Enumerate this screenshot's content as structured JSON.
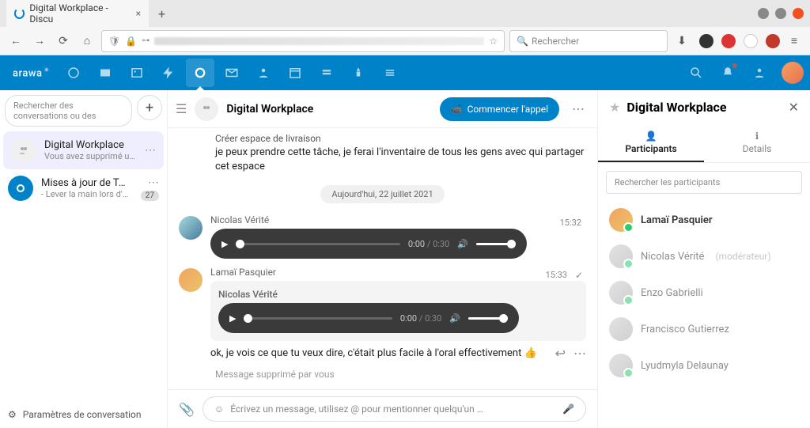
{
  "browser": {
    "tab_title": "Digital Workplace - Discu",
    "search_placeholder": "Rechercher"
  },
  "app": {
    "brand": "arawa"
  },
  "sidebar": {
    "search_placeholder": "Rechercher des conversations ou des",
    "items": [
      {
        "title": "Digital Workplace",
        "subtitle": "Vous avez supprimé un mes…"
      },
      {
        "title": "Mises à jour de Talk ✅",
        "subtitle": "- Lever la main lors d'u…",
        "badge": "27"
      }
    ],
    "footer": "Paramètres de conversation"
  },
  "chat": {
    "title": "Digital Workplace",
    "start_call": "Commencer l'appel",
    "system_line": "Créer espace de livraison",
    "intro_msg": "je peux prendre cette tâche, je ferai l'inventaire de tous les gens avec qui partager cet espace",
    "date_divider": "Aujourd'hui, 22 juillet 2021",
    "msg1": {
      "author": "Nicolas Vérité",
      "time": "15:32",
      "audio_pos": "0:00",
      "audio_dur": "/ 0:30"
    },
    "msg2": {
      "author": "Lamaï Pasquier",
      "time": "15:33",
      "quote_author": "Nicolas Vérité",
      "audio_pos": "0:00",
      "audio_dur": "/ 0:30",
      "reply_text": "ok, je vois ce que tu veux dire, c'était plus facile à l'oral effectivement 👍"
    },
    "deleted": "Message supprimé par vous",
    "input_placeholder": "Écrivez un message, utilisez @ pour mentionner quelqu'un …"
  },
  "right": {
    "title": "Digital Workplace",
    "tabs": {
      "participants": "Participants",
      "details": "Details"
    },
    "search_placeholder": "Rechercher les participants",
    "participants": [
      {
        "name": "Lamaï Pasquier",
        "online": true,
        "self": true
      },
      {
        "name": "Nicolas Vérité",
        "role": "(modérateur)",
        "online": true
      },
      {
        "name": "Enzo Gabrielli",
        "online": true
      },
      {
        "name": "Francisco Gutierrez"
      },
      {
        "name": "Lyudmyla Delaunay",
        "online": true
      }
    ]
  }
}
